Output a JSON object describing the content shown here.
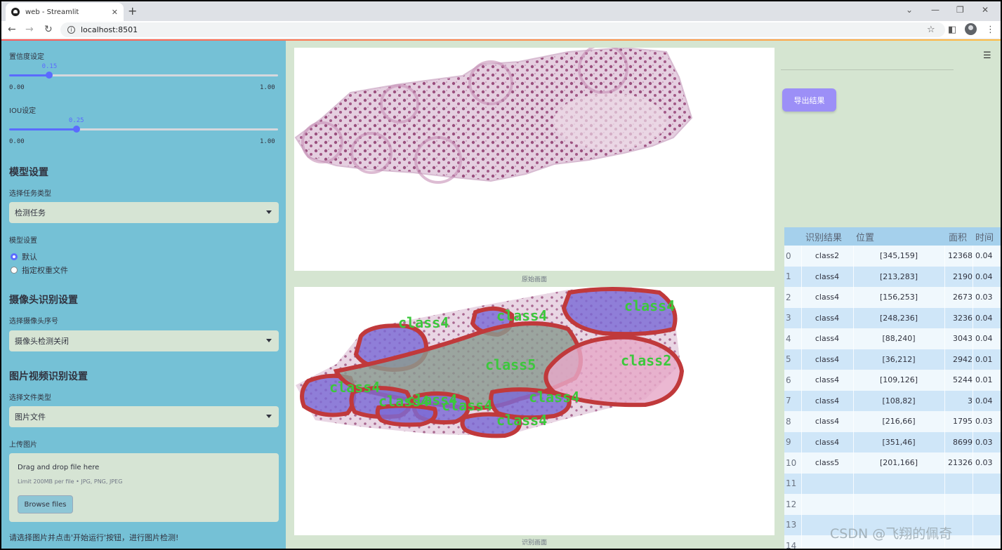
{
  "browser": {
    "tab_title": "web - Streamlit",
    "url": "localhost:8501"
  },
  "sidebar": {
    "conf_label": "置信度设定",
    "conf": {
      "value_text": "0.15",
      "value": 0.15,
      "min": "0.00",
      "max": "1.00"
    },
    "iou_label": "IOU设定",
    "iou": {
      "value_text": "0.25",
      "value": 0.25,
      "min": "0.00",
      "max": "1.00"
    },
    "model_heading": "模型设置",
    "task_label": "选择任务类型",
    "task_value": "检测任务",
    "model_label": "模型设置",
    "model_options": [
      "默认",
      "指定权重文件"
    ],
    "camera_heading": "摄像头识别设置",
    "camera_label": "选择摄像头序号",
    "camera_value": "摄像头检测关闭",
    "media_heading": "图片视频识别设置",
    "filetype_label": "选择文件类型",
    "filetype_value": "图片文件",
    "upload_label": "上传图片",
    "dropzone": {
      "title": "Drag and drop file here",
      "limit": "Limit 200MB per file • JPG, PNG, JPEG",
      "button": "Browse files"
    },
    "footer_hint": "请选择图片并点击'开始运行'按钮，进行图片检测!"
  },
  "main": {
    "caption_original": "原始画面",
    "caption_result": "识别画面",
    "export_label": "导出结果",
    "table": {
      "headers": [
        "",
        "识别结果",
        "位置",
        "面积",
        "时间"
      ],
      "rows": [
        [
          "0",
          "class2",
          "[345,159]",
          "12368",
          "0.04"
        ],
        [
          "1",
          "class4",
          "[213,283]",
          "2190",
          "0.04"
        ],
        [
          "2",
          "class4",
          "[156,253]",
          "2673",
          "0.03"
        ],
        [
          "3",
          "class4",
          "[248,236]",
          "3236",
          "0.04"
        ],
        [
          "4",
          "class4",
          "[88,240]",
          "3043",
          "0.04"
        ],
        [
          "5",
          "class4",
          "[36,212]",
          "2942",
          "0.01"
        ],
        [
          "6",
          "class4",
          "[109,126]",
          "5244",
          "0.01"
        ],
        [
          "7",
          "class4",
          "[108,82]",
          "3",
          "0.04"
        ],
        [
          "8",
          "class4",
          "[216,66]",
          "1795",
          "0.03"
        ],
        [
          "9",
          "class4",
          "[351,46]",
          "8699",
          "0.03"
        ],
        [
          "10",
          "class5",
          "[201,166]",
          "21326",
          "0.03"
        ],
        [
          "11",
          "",
          "",
          "",
          ""
        ],
        [
          "12",
          "",
          "",
          "",
          ""
        ],
        [
          "13",
          "",
          "",
          "",
          ""
        ],
        [
          "14",
          "",
          "",
          "",
          ""
        ]
      ]
    },
    "detections": [
      {
        "label": "class4"
      },
      {
        "label": "class4"
      },
      {
        "label": "class4"
      },
      {
        "label": "class4"
      },
      {
        "label": "class5"
      },
      {
        "label": "class2"
      },
      {
        "label": "class4"
      },
      {
        "label": "class4"
      },
      {
        "label": "class4"
      },
      {
        "label": "class4"
      },
      {
        "label": "class4"
      }
    ]
  },
  "watermark": "CSDN @飞翔的佩奇",
  "colors": {
    "sidebar_bg": "#75c1d6",
    "main_bg": "#d5e5d1",
    "accent": "#5b6bff",
    "export_btn": "#9c8ff7",
    "detect_outline": "#c0393b",
    "class4_fill": "#7b6ad6",
    "class5_fill": "#8a9a90",
    "class2_fill": "#e6a8c8",
    "detect_text": "#3cc83c"
  }
}
